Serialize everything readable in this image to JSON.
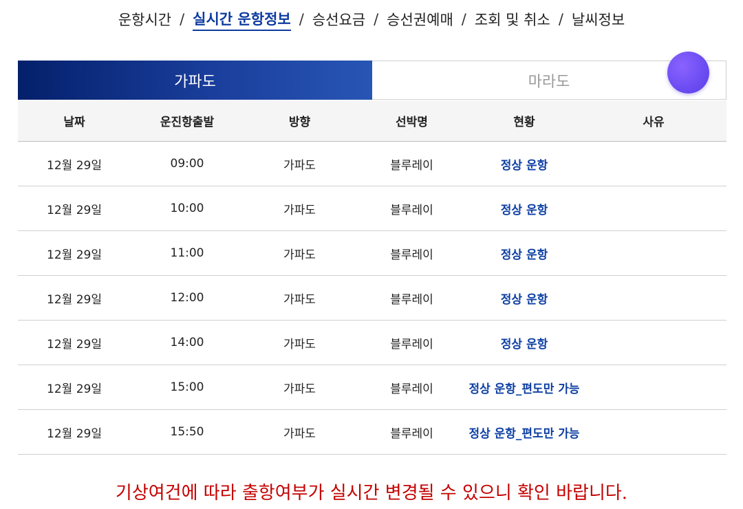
{
  "nav": {
    "items": [
      {
        "label": "운항시간",
        "active": false
      },
      {
        "label": "실시간 운항정보",
        "active": true
      },
      {
        "label": "승선요금",
        "active": false
      },
      {
        "label": "승선권예매",
        "active": false
      },
      {
        "label": "조회 및 취소",
        "active": false
      },
      {
        "label": "날씨정보",
        "active": false
      }
    ],
    "separator": "/"
  },
  "tabs": {
    "gapado": "가파도",
    "marado": "마라도"
  },
  "table": {
    "headers": [
      "날짜",
      "운진항출발",
      "방향",
      "선박명",
      "현황",
      "사유"
    ],
    "rows": [
      {
        "date": "12월 29일",
        "departure": "09:00",
        "direction": "가파도",
        "ship": "블루레이",
        "status": "정상 운항",
        "reason": ""
      },
      {
        "date": "12월 29일",
        "departure": "10:00",
        "direction": "가파도",
        "ship": "블루레이",
        "status": "정상 운항",
        "reason": ""
      },
      {
        "date": "12월 29일",
        "departure": "11:00",
        "direction": "가파도",
        "ship": "블루레이",
        "status": "정상 운항",
        "reason": ""
      },
      {
        "date": "12월 29일",
        "departure": "12:00",
        "direction": "가파도",
        "ship": "블루레이",
        "status": "정상 운항",
        "reason": ""
      },
      {
        "date": "12월 29일",
        "departure": "14:00",
        "direction": "가파도",
        "ship": "블루레이",
        "status": "정상 운항",
        "reason": ""
      },
      {
        "date": "12월 29일",
        "departure": "15:00",
        "direction": "가파도",
        "ship": "블루레이",
        "status": "정상 운항_편도만 가능",
        "reason": ""
      },
      {
        "date": "12월 29일",
        "departure": "15:50",
        "direction": "가파도",
        "ship": "블루레이",
        "status": "정상 운항_편도만 가능",
        "reason": ""
      }
    ]
  },
  "notice": "기상여건에 따라 출항여부가 실시간 변경될 수 있으니 확인 바랍니다.",
  "colors": {
    "accent": "#0c3aa0",
    "status": "#0d3fa3",
    "notice": "#c40000",
    "floating_button": "#6b4cf2"
  },
  "icons": {
    "floating_button": "circle-button-icon"
  }
}
